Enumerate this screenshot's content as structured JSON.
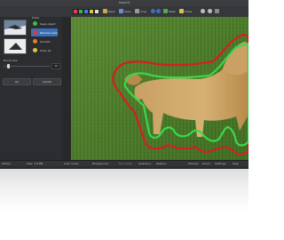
{
  "window": {
    "title": "Inpaint"
  },
  "toolbar": {
    "items": [
      {
        "icon": "open-icon",
        "label": "Open"
      },
      {
        "icon": "save-icon",
        "label": "Save"
      },
      {
        "icon": "crop-icon",
        "label": "Crop"
      },
      {
        "icon": "mask-icon",
        "label": "Mask"
      },
      {
        "icon": "erase-icon",
        "label": "Erase"
      }
    ]
  },
  "left_panel": {
    "tools_label": "Mode",
    "tools": [
      {
        "icon": "keep-region-icon",
        "label": "Keep object",
        "active": false,
        "color": "#36c24a"
      },
      {
        "icon": "remove-region-icon",
        "label": "Remove area",
        "active": true,
        "color": "#e03a3a"
      },
      {
        "icon": "brush-icon",
        "label": "Smooth",
        "active": false,
        "color": "#e87a2a"
      },
      {
        "icon": "clear-icon",
        "label": "Clear all",
        "active": false,
        "color": "#e0c040"
      }
    ],
    "slider_label": "Brush size",
    "slider_value": "10",
    "slider_fraction": 0.08,
    "ok_label": "Go",
    "cancel_label": "Cancel"
  },
  "statusbar": {
    "left": [
      "Status",
      "Size: 3.8 MB"
    ],
    "tabs": [
      "Auto mode",
      "Background",
      "Fine mask",
      "Selection",
      "Restore"
    ],
    "right": [
      "Preview",
      "Zoom",
      "Settings",
      "Help"
    ]
  },
  "colors": {
    "keep": "#39d84a",
    "remove": "#d82020",
    "accent": "#3c6fb5"
  }
}
